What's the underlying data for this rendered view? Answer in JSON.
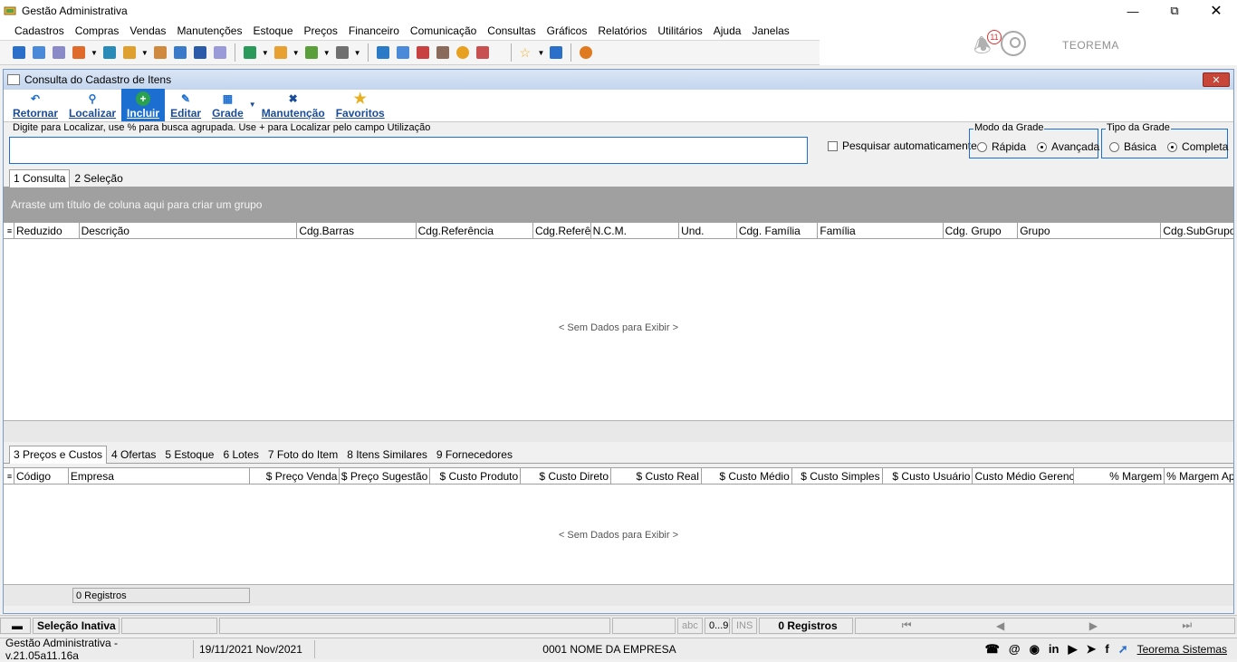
{
  "window": {
    "title": "Gestão Administrativa"
  },
  "menu": [
    "Cadastros",
    "Compras",
    "Vendas",
    "Manutenções",
    "Estoque",
    "Preços",
    "Financeiro",
    "Comunicação",
    "Consultas",
    "Gráficos",
    "Relatórios",
    "Utilitários",
    "Ajuda",
    "Janelas"
  ],
  "notifications": {
    "count": "11"
  },
  "brand": "TEOREMA",
  "child": {
    "title": "Consulta do Cadastro de Itens",
    "ribbon": [
      "Retornar",
      "Localizar",
      "Incluir",
      "Editar",
      "Grade",
      "Manutenção",
      "Favoritos"
    ],
    "hint": "Digite para Localizar, use % para busca agrupada. Use + para Localizar pelo campo Utilização",
    "search_value": "",
    "auto_search_label": "Pesquisar automaticamente",
    "modo_grade": {
      "title": "Modo da Grade",
      "options": [
        "Rápida",
        "Avançada"
      ],
      "selected": "Avançada"
    },
    "tipo_grade": {
      "title": "Tipo da Grade",
      "options": [
        "Básica",
        "Completa"
      ],
      "selected": "Completa"
    },
    "tabs_top": [
      "1 Consulta",
      "2 Seleção"
    ],
    "groupby_hint": "Arraste um título de coluna aqui para criar um grupo",
    "grid1_columns": [
      "Reduzido",
      "Descrição",
      "Cdg.Barras",
      "Cdg.Referência",
      "Cdg.Referên",
      "N.C.M.",
      "Und.",
      "Cdg. Família",
      "Família",
      "Cdg. Grupo",
      "Grupo",
      "Cdg.SubGrupo"
    ],
    "nodata": "< Sem Dados para Exibir >",
    "tabs_bottom": [
      "3 Preços e Custos",
      "4 Ofertas",
      "5 Estoque",
      "6 Lotes",
      "7 Foto do Item",
      "8 Itens Similares",
      "9 Fornecedores"
    ],
    "grid2_columns": [
      "Código",
      "Empresa",
      "$ Preço Venda",
      "$ Preço Sugestão",
      "$ Custo Produto",
      "$ Custo Direto",
      "$ Custo Real",
      "$ Custo Médio",
      "$ Custo Simples",
      "$ Custo Usuário",
      "Custo Médio Gerencial",
      "% Margem",
      "% Margem Apl"
    ],
    "grid2_footer": "0 Registros"
  },
  "status": {
    "selection": "Seleção Inativa",
    "abc": "abc",
    "digits": "0...9",
    "ins": "INS",
    "records": "0 Registros"
  },
  "bottom": {
    "version": "Gestão Administrativa - v.21.05a11.16a",
    "date": "19/11/2021 Nov/2021",
    "company": "0001 NOME DA EMPRESA",
    "link": "Teorema Sistemas"
  }
}
